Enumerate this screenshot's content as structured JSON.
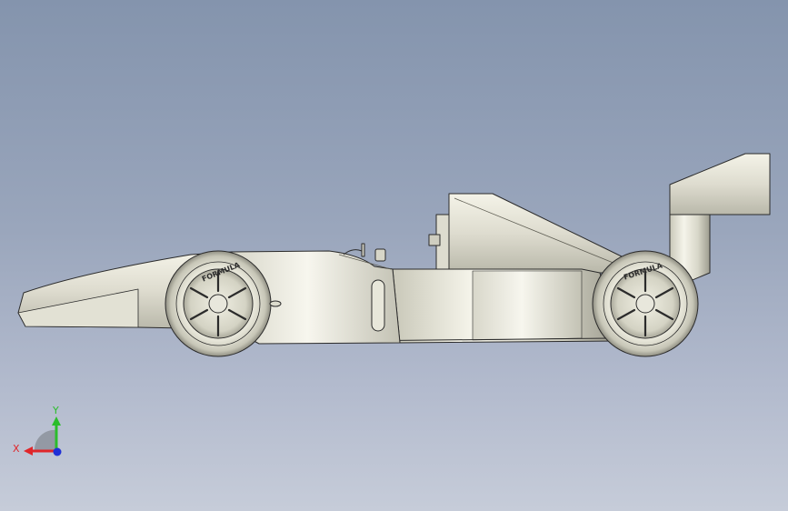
{
  "wheel_text": {
    "front": "FORMULA",
    "rear": "FORMULA"
  },
  "triad": {
    "x_label": "X",
    "y_label": "Y",
    "x_color": "#e0262a",
    "y_color": "#2bbd2b",
    "z_color": "#1f2fd6"
  },
  "colors": {
    "body_light": "#ecebde",
    "body_mid": "#d2d1c2",
    "body_dark": "#8e8d80",
    "outline": "#2b2b2b",
    "background_top": "#8494ad",
    "background_bottom": "#c6ccd9"
  }
}
